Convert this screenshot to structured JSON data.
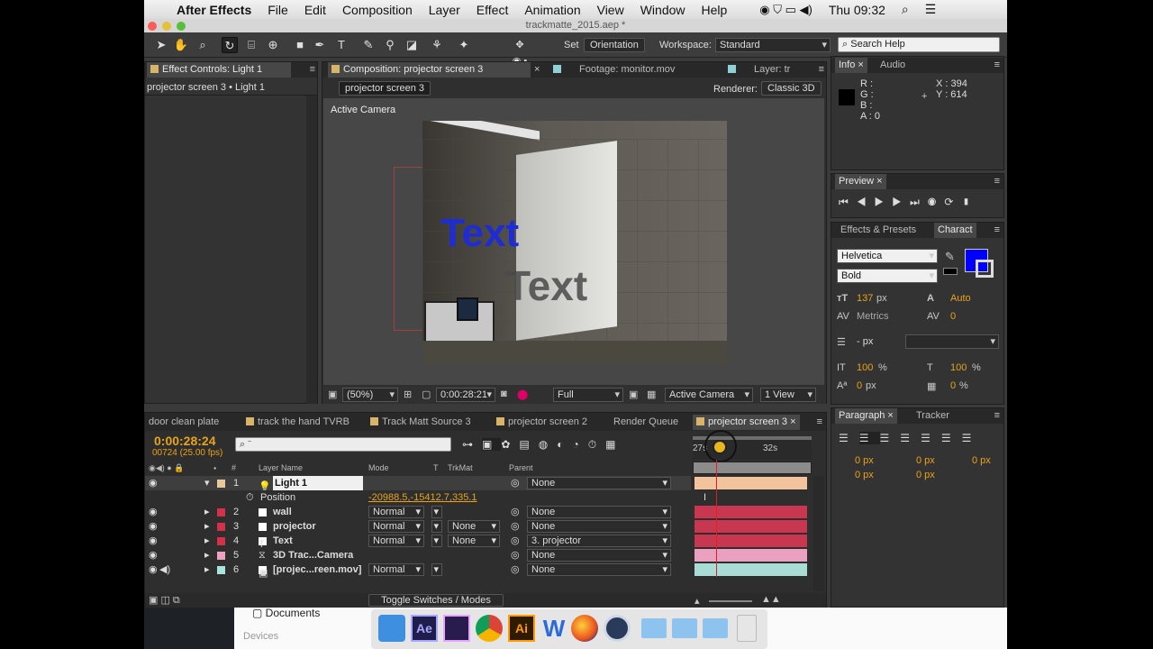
{
  "menubar": {
    "apple": "",
    "app": "After Effects",
    "items": [
      "File",
      "Edit",
      "Composition",
      "Layer",
      "Effect",
      "Animation",
      "View",
      "Window",
      "Help"
    ],
    "clock": "Thu 09:32"
  },
  "window_title": "trackmatte_2015.aep *",
  "toolbar": {
    "set_label": "Set",
    "orientation": "Orientation",
    "workspace_label": "Workspace:",
    "workspace_value": "Standard",
    "search_placeholder": "Search Help"
  },
  "effect_controls": {
    "tab": "Effect Controls: Light 1",
    "subtitle": "projector screen 3 • Light 1"
  },
  "composition": {
    "tab": "Composition: projector screen 3",
    "footage_tab": "Footage: monitor.mov",
    "layer_tab": "Layer: tr",
    "comp_name_button": "projector screen 3",
    "renderer_label": "Renderer:",
    "renderer_value": "Classic 3D",
    "view_label": "Active Camera",
    "overlay_text_blue": "Text",
    "overlay_text_shadow": "Text",
    "bottom": {
      "zoom": "(50%)",
      "timecode": "0:00:28:21",
      "resolution": "Full",
      "camera": "Active Camera",
      "views": "1 View"
    }
  },
  "info": {
    "tab": "Info",
    "audio_tab": "Audio",
    "r": "R :",
    "g": "G :",
    "b": "B :",
    "a": "A : 0",
    "x": "X : 394",
    "y": "Y : 614"
  },
  "preview": {
    "tab": "Preview"
  },
  "character": {
    "effects_tab": "Effects & Presets",
    "tab": "Charact",
    "font": "Helvetica",
    "style": "Bold",
    "size": "137",
    "size_unit": "px",
    "leading": "Auto",
    "kerning": "Metrics",
    "tracking": "0",
    "stroke": "- px",
    "vscale": "100",
    "vscale_unit": "%",
    "hscale": "100",
    "hscale_unit": "%",
    "baseline": "0",
    "baseline_unit": "px",
    "tsume": "0",
    "tsume_unit": "%",
    "fill_color": "#0000ff",
    "stroke_color": "#ffffff"
  },
  "paragraph": {
    "tab": "Paragraph",
    "tracker_tab": "Tracker",
    "indent1": "0 px",
    "indent2": "0 px",
    "indent3": "0 px",
    "space1": "0 px",
    "space2": "0 px"
  },
  "timeline": {
    "tabs": [
      "door clean plate",
      "track the hand TVRB",
      "Track Matt Source 3",
      "projector screen 2",
      "Render Queue",
      "projector screen 3"
    ],
    "current_time": "0:00:28:24",
    "frame_info": "00724 (25.00 fps)",
    "search_value": "⌕ ⁻",
    "columns": {
      "layer_name": "Layer Name",
      "mode": "Mode",
      "t": "T",
      "trkmat": "TrkMat",
      "parent": "Parent"
    },
    "ruler": [
      "27s",
      "32s"
    ],
    "position_label": "Position",
    "position_value": "-20988.5,-15412.7,335.1",
    "layers": [
      {
        "num": "1",
        "name": "Light 1",
        "mode": "",
        "trkmat": "",
        "parent": "None",
        "color": "#e8c79b",
        "bar": "#f3c39e"
      },
      {
        "num": "2",
        "name": "wall",
        "mode": "Normal",
        "trkmat": "",
        "parent": "None",
        "color": "#d4304a",
        "bar": "#c8364f"
      },
      {
        "num": "3",
        "name": "projector",
        "mode": "Normal",
        "trkmat": "None",
        "parent": "None",
        "color": "#d4304a",
        "bar": "#c8364f"
      },
      {
        "num": "4",
        "name": "Text",
        "mode": "Normal",
        "trkmat": "None",
        "parent": "3. projector",
        "color": "#d4304a",
        "bar": "#c8364f"
      },
      {
        "num": "5",
        "name": "3D Trac...Camera",
        "mode": "",
        "trkmat": "",
        "parent": "None",
        "color": "#f0a0c0",
        "bar": "#eba0bf"
      },
      {
        "num": "6",
        "name": "[projec...reen.mov]",
        "mode": "Normal",
        "trkmat": "",
        "parent": "None",
        "color": "#a9e3dc",
        "bar": "#a8ddd6"
      }
    ],
    "toggle_label": "Toggle Switches / Modes"
  },
  "finder": {
    "documents": "Documents",
    "devices": "Devices"
  },
  "dock": [
    "finder-icon",
    "after-effects-icon",
    "premiere-icon",
    "chrome-icon",
    "illustrator-icon",
    "word-icon",
    "firefox-icon",
    "quicktime-icon",
    "folder-icon",
    "folder-icon",
    "folder-icon",
    "trash-icon"
  ]
}
